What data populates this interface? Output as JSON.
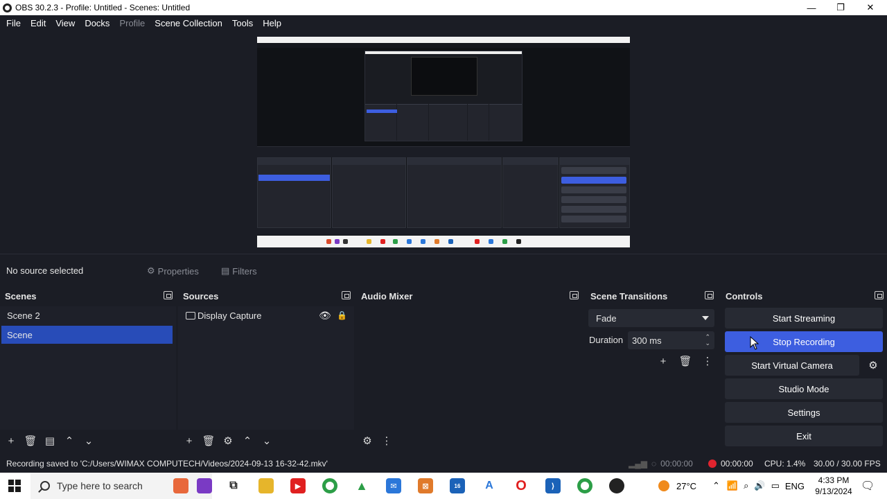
{
  "window": {
    "title": "OBS 30.2.3 - Profile: Untitled - Scenes: Untitled",
    "minimize_icon": "—",
    "restore_icon": "❐",
    "close_icon": "✕"
  },
  "menu": [
    "File",
    "Edit",
    "View",
    "Docks",
    "Profile",
    "Scene Collection",
    "Tools",
    "Help"
  ],
  "source_toolbar": {
    "status": "No source selected",
    "properties_label": "Properties",
    "filters_label": "Filters"
  },
  "scenes": {
    "title": "Scenes",
    "items": [
      "Scene 2",
      "Scene"
    ],
    "selected": "Scene"
  },
  "sources": {
    "title": "Sources",
    "items": [
      {
        "label": "Display Capture",
        "visible": true,
        "locked": true
      }
    ]
  },
  "audio_mixer": {
    "title": "Audio Mixer"
  },
  "transitions": {
    "title": "Scene Transitions",
    "selected": "Fade",
    "duration_label": "Duration",
    "duration_value": "300 ms"
  },
  "controls": {
    "title": "Controls",
    "start_streaming": "Start Streaming",
    "stop_recording": "Stop Recording",
    "start_virtual_camera": "Start Virtual Camera",
    "studio_mode": "Studio Mode",
    "settings": "Settings",
    "exit": "Exit"
  },
  "status": {
    "message": "Recording saved to 'C:/Users/WIMAX COMPUTECH/Videos/2024-09-13 16-32-42.mkv'",
    "stream_time": "00:00:00",
    "record_time": "00:00:00",
    "cpu": "CPU: 1.4%",
    "fps": "30.00 / 30.00 FPS",
    "record_color": "#e0242f"
  },
  "taskbar": {
    "search_placeholder": "Type here to search",
    "temperature": "27°C",
    "language": "ENG",
    "time": "4:33 PM",
    "date": "9/13/2024",
    "teams_badge": "16"
  },
  "colors": {
    "accent": "#3d5ee0",
    "selection": "#284cb8",
    "background": "#1b1d25"
  }
}
